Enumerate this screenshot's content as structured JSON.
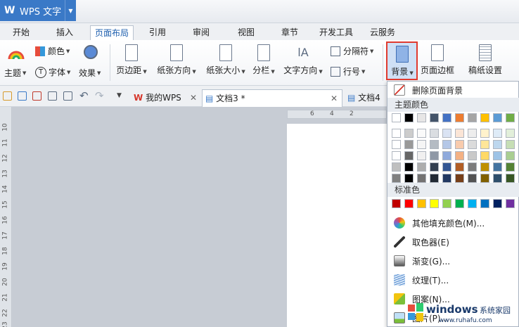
{
  "app": {
    "name": "WPS 文字"
  },
  "tabs": [
    "开始",
    "插入",
    "页面布局",
    "引用",
    "审阅",
    "视图",
    "章节",
    "开发工具",
    "云服务"
  ],
  "ribbon": {
    "colors_label": "颜色",
    "theme_label": "主题",
    "font_label": "字体",
    "effects_label": "效果",
    "margins_label": "页边距",
    "orientation_label": "纸张方向",
    "size_label": "纸张大小",
    "columns_label": "分栏",
    "text_direction_label": "文字方向",
    "separator_label": "分隔符",
    "line_number_label": "行号",
    "background_label": "背景",
    "page_border_label": "页面边框",
    "manuscript_label": "稿纸设置"
  },
  "doc_tabs": {
    "my_wps": "我的WPS",
    "doc3": "文档3 *",
    "doc4": "文档4 *"
  },
  "ruler": {
    "horizontal": [
      "6",
      "4",
      "2"
    ],
    "vertical": [
      "10",
      "11",
      "12",
      "13",
      "14",
      "15",
      "16",
      "17",
      "18",
      "19",
      "20",
      "21",
      "22",
      "23"
    ]
  },
  "menu": {
    "delete_bg": "删除页面背景",
    "theme_colors_header": "主题颜色",
    "standard_colors_header": "标准色",
    "more_fill": "其他填充颜色(M)...",
    "eyedropper": "取色器(E)",
    "gradient": "渐变(G)...",
    "texture": "纹理(T)...",
    "pattern": "图案(N)...",
    "picture": "图片(P)..."
  },
  "theme_colors_top": [
    "#ffffff",
    "#000000",
    "#e7e6e6",
    "#44546a",
    "#4472c4",
    "#ed7d31",
    "#a5a5a5",
    "#ffc000",
    "#5b9bd5",
    "#70ad47"
  ],
  "standard_colors": [
    "#c00000",
    "#ff0000",
    "#ffc000",
    "#ffff00",
    "#92d050",
    "#00b050",
    "#00b0f0",
    "#0070c0",
    "#002060",
    "#7030a0"
  ],
  "watermark": {
    "brand": "windows",
    "tagline": "系统家园",
    "url": "www.ruhafu.com"
  }
}
